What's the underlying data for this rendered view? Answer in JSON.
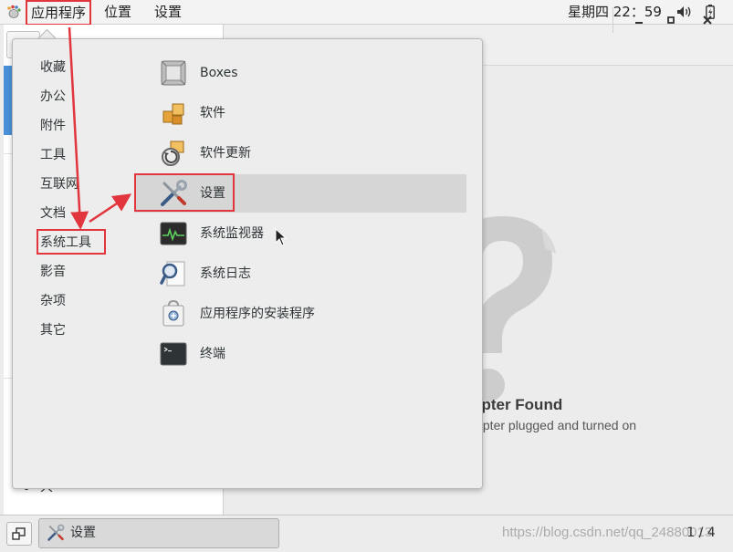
{
  "topbar": {
    "apps_label": "应用程序",
    "places_label": "位置",
    "settings_label": "设置",
    "clock": "星期四 22：59",
    "icons": {
      "apps": "gnome-foot-icon",
      "volume": "volume-icon",
      "battery": "battery-icon"
    }
  },
  "background_window": {
    "no_adapter_title": "apter Found",
    "no_adapter_subtitle": "lapter plugged and turned on",
    "left_tail_text": "大",
    "icons": {
      "minimize": "minimize-icon",
      "maximize": "maximize-icon",
      "close": "close-icon",
      "placeholder": "question-mark-icon"
    }
  },
  "menu": {
    "categories": [
      {
        "label": "收藏"
      },
      {
        "label": "办公"
      },
      {
        "label": "附件"
      },
      {
        "label": "工具"
      },
      {
        "label": "互联网"
      },
      {
        "label": "文档"
      },
      {
        "label": "系统工具"
      },
      {
        "label": "影音"
      },
      {
        "label": "杂项"
      },
      {
        "label": "其它"
      }
    ],
    "selected_category": "系统工具",
    "apps": [
      {
        "label": "Boxes",
        "icon": "boxes-icon"
      },
      {
        "label": "软件",
        "icon": "software-icon"
      },
      {
        "label": "软件更新",
        "icon": "software-update-icon"
      },
      {
        "label": "设置",
        "icon": "settings-tools-icon"
      },
      {
        "label": "系统监视器",
        "icon": "system-monitor-icon"
      },
      {
        "label": "系统日志",
        "icon": "system-log-icon"
      },
      {
        "label": "应用程序的安装程序",
        "icon": "app-installer-icon"
      },
      {
        "label": "终端",
        "icon": "terminal-icon"
      }
    ],
    "hovered_app": "设置"
  },
  "taskbar": {
    "window_label": "设置",
    "pager": "1 / 4",
    "watermark": "https://blog.csdn.net/qq_24880013"
  },
  "colors": {
    "annotation_red": "#e2363f",
    "hover_row": "#d6d6d6",
    "selection_blue": "#4a90d9"
  }
}
